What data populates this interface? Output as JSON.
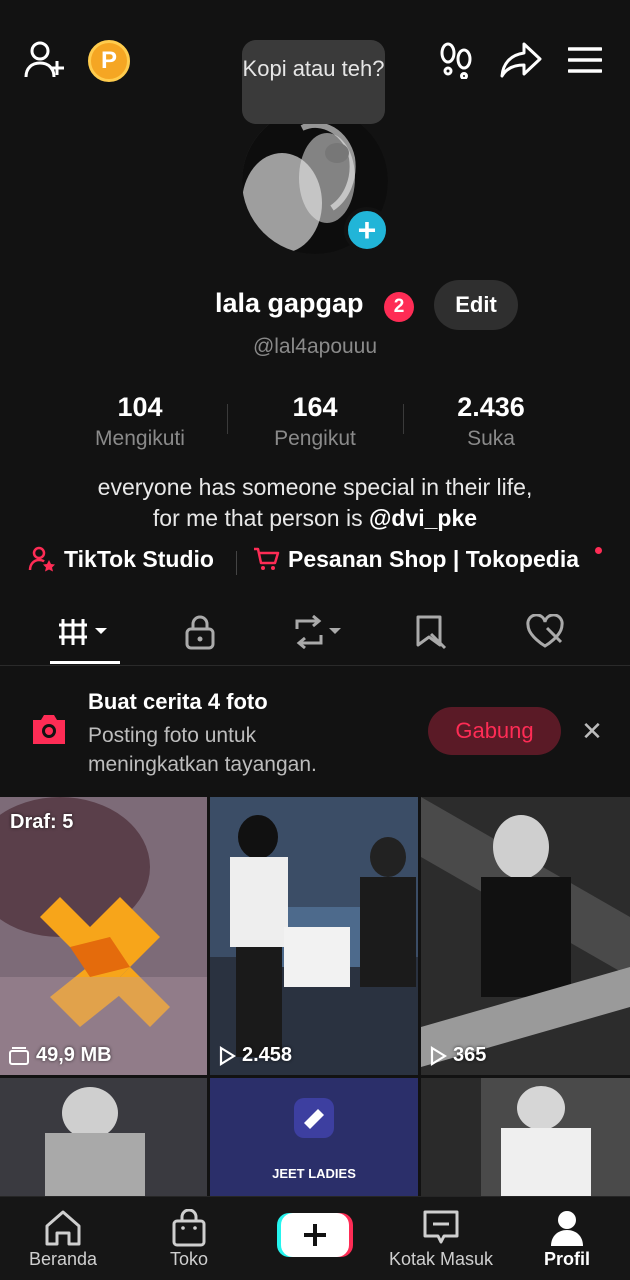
{
  "header": {
    "add_friend_icon": "add-person-icon",
    "coin_label": "P",
    "footprint_icon": "footprints-icon",
    "share_icon": "share-arrow-icon",
    "menu_icon": "hamburger-menu-icon"
  },
  "bubble": {
    "text": "Kopi atau teh?"
  },
  "profile": {
    "display_name": "lala gapgap",
    "notification_count": "2",
    "edit_label": "Edit",
    "handle": "@lal4apouuu"
  },
  "stats": [
    {
      "value": "104",
      "label": "Mengikuti"
    },
    {
      "value": "164",
      "label": "Pengikut"
    },
    {
      "value": "2.436",
      "label": "Suka"
    }
  ],
  "bio": {
    "line1": "everyone has someone special in their life,",
    "line2_prefix": "for me that person is ",
    "line2_mention": "@dvi_pke"
  },
  "links": {
    "studio": "TikTok Studio",
    "shop": "Pesanan Shop | Tokopedia"
  },
  "tabs": [
    "videos-grid-icon",
    "lock-icon",
    "repost-icon",
    "bookmark-icon",
    "liked-heart-icon"
  ],
  "promo": {
    "title": "Buat cerita 4 foto",
    "subtitle": "Posting foto untuk meningkatkan tayangan.",
    "join_label": "Gabung",
    "close_label": "✕"
  },
  "grid": {
    "draft_label": "Draf: 5",
    "items": [
      {
        "overlay": "49,9 MB"
      },
      {
        "overlay": "2.458"
      },
      {
        "overlay": "365"
      }
    ],
    "row2_caption": "JEET LADIES"
  },
  "bottom_nav": {
    "home": "Beranda",
    "shop": "Toko",
    "inbox": "Kotak Masuk",
    "profile": "Profil"
  },
  "colors": {
    "background": "#121212",
    "accent": "#fe2c55",
    "avatar_plus": "#21b5d8",
    "coin": "#f5a623"
  }
}
